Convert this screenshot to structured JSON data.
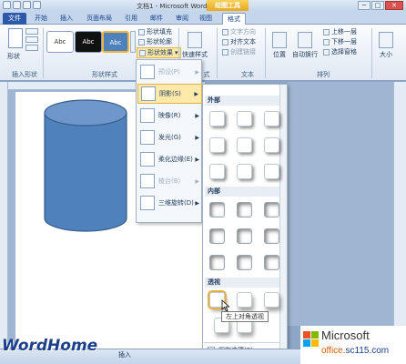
{
  "window": {
    "title": "文档1 - Microsoft Word",
    "context_tab_group": "绘图工具",
    "min": "─",
    "max": "□",
    "close": "✕"
  },
  "tabs": [
    {
      "label": "文件"
    },
    {
      "label": "开始"
    },
    {
      "label": "插入"
    },
    {
      "label": "页面布局"
    },
    {
      "label": "引用"
    },
    {
      "label": "邮件"
    },
    {
      "label": "审阅"
    },
    {
      "label": "视图"
    },
    {
      "label": "格式"
    }
  ],
  "ribbon": {
    "insert_shapes": {
      "label": "插入形状",
      "shapes_btn": "形状"
    },
    "shape_styles": {
      "label": "形状样式",
      "thumbs": [
        "Abc",
        "Abc",
        "Abc"
      ],
      "fill": "形状填充",
      "outline": "形状轮廓",
      "effects": "形状效果"
    },
    "wordart": {
      "quick_styles": "快速样式",
      "label": "式"
    },
    "text": {
      "label": "文本",
      "direction": "文字方向",
      "align": "对齐文本",
      "link": "创建链接"
    },
    "arrange": {
      "label": "排列",
      "position": "位置",
      "wrap": "自动换行",
      "bring_forward": "上移一层",
      "send_backward": "下移一层",
      "selection_pane": "选择窗格"
    },
    "size": {
      "label": "大小"
    }
  },
  "effects_menu": {
    "items": [
      {
        "label": "预设(P)",
        "disabled": true
      },
      {
        "label": "阴影(S)",
        "selected": true
      },
      {
        "label": "映像(R)"
      },
      {
        "label": "发光(G)"
      },
      {
        "label": "柔化边缘(E)"
      },
      {
        "label": "棱台(B)",
        "disabled": true
      },
      {
        "label": "三维旋转(D)"
      }
    ]
  },
  "shadow_gallery": {
    "sections": [
      {
        "title": "外部"
      },
      {
        "title": "内部"
      },
      {
        "title": "透视"
      }
    ],
    "tooltip": "左上对角透视",
    "footer": "阴影选项(S)..."
  },
  "statusbar": {
    "insert_mode": "插入"
  },
  "watermarks": {
    "wordhome": "WordHome",
    "ms_brand": "Microsoft",
    "site_prefix": "office",
    "site_suffix": ".sc115.com"
  },
  "colors": {
    "shape_fill": "#4f81bd",
    "shape_outline": "#385d8a",
    "file_tab": "#2a5aa8",
    "highlight": "#fde9a9"
  }
}
